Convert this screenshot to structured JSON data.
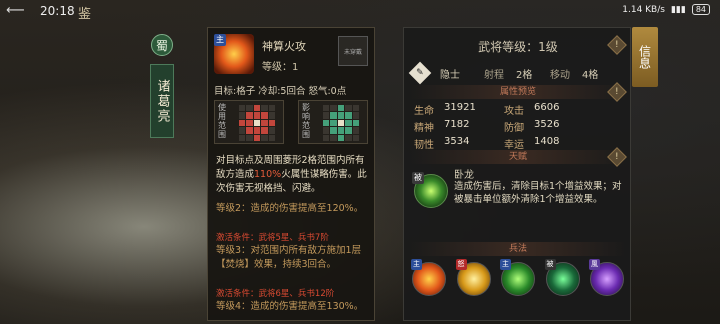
{
  "status": {
    "time": "20:18",
    "title_glyph": "鉴",
    "network": "1.14 KB/s",
    "battery": "84"
  },
  "hero": {
    "faction": "蜀",
    "name": "诸葛亮"
  },
  "skill": {
    "name": "神算火攻",
    "level": "等级：1",
    "unlearned": "未穿戴",
    "target_line": "目标:格子 冷却:5回合 怒气:0点",
    "range_used": "使用范围",
    "range_affect": "影响范围",
    "desc_1": "对目标点及周围菱形2格范围内所有敌方造成",
    "desc_pct": "110%",
    "desc_2": "火属性谋略伤害。此次伤害无视格挡、闪避。",
    "lv2": "等级2：造成的伤害提高至120%。",
    "lv2_req": "激活条件：武将5星、兵书7阶",
    "lv3": "等级3：对范围内所有敌方施加1层【焚烧】效果，持续3回合。",
    "lv3_req": "激活条件：武将6星、兵书12阶",
    "lv4": "等级4：造成的伤害提高至130%。"
  },
  "info": {
    "tab": "信息",
    "rank": "武将等级：1级",
    "unit": "隐士",
    "range_label": "射程",
    "range_val": "2格",
    "move_label": "移动",
    "move_val": "4格",
    "attr_title": "属性预览",
    "stats": [
      {
        "l1": "生命",
        "v1": "31921",
        "l2": "攻击",
        "v2": "6606"
      },
      {
        "l1": "精神",
        "v1": "7182",
        "l2": "防御",
        "v2": "3526"
      },
      {
        "l1": "韧性",
        "v1": "3534",
        "l2": "幸运",
        "v2": "1408"
      }
    ],
    "talent_title": "天赋",
    "talent_name": "卧龙",
    "talent_desc": "造成伤害后，清除目标1个增益效果；对被暴击单位额外清除1个增益效果。",
    "ability_title": "兵法",
    "abilities": [
      {
        "tag": "主",
        "color": "#2d4f9a",
        "icon": "fire-icon"
      },
      {
        "tag": "怒",
        "color": "#b32a2a",
        "icon": "gold-rune-icon"
      },
      {
        "tag": "主",
        "color": "#2d4f9a",
        "icon": "green-strike-icon"
      },
      {
        "tag": "被",
        "color": "#333",
        "icon": "green-figure-icon"
      },
      {
        "tag": "風",
        "color": "#5a3a9a",
        "icon": "purple-vortex-icon"
      }
    ]
  }
}
